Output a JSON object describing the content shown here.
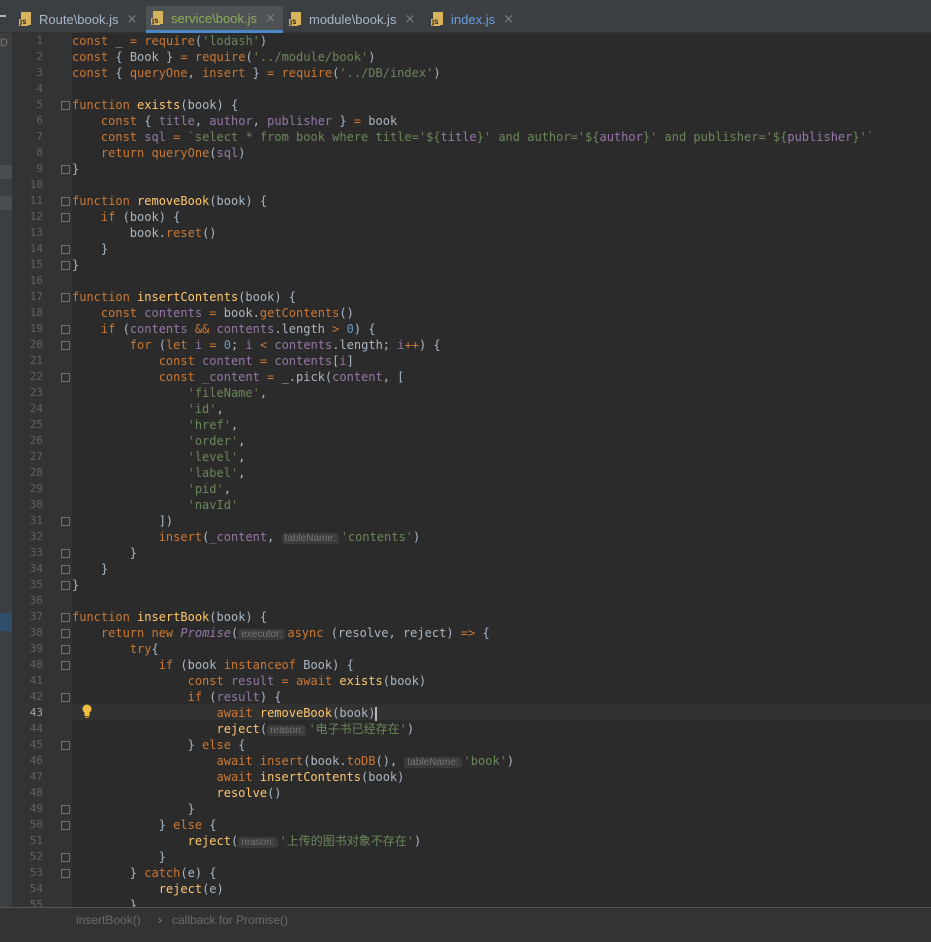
{
  "tabs": [
    {
      "label": "Route\\book.js",
      "color": "#a9b7c6",
      "active": false
    },
    {
      "label": "service\\book.js",
      "color": "#8fac5a",
      "active": true
    },
    {
      "label": "module\\book.js",
      "color": "#a9b7c6",
      "active": false
    },
    {
      "label": "index.js",
      "color": "#6a9ee4",
      "active": false
    }
  ],
  "tab_icon_text": "JS",
  "close_glyph": "×",
  "hints": {
    "tableName": "tableName:",
    "executor": "executor:",
    "reason": "reason:"
  },
  "strings": {
    "book_exists": "'电子书已经存在'",
    "book_missing": "'上传的图书对象不存在'"
  },
  "breadcrumb": {
    "item1": "insertBook()",
    "separator": "›",
    "item2": "callback for Promise()"
  },
  "left_label": "D",
  "line_numbers": [
    1,
    2,
    3,
    4,
    5,
    6,
    7,
    8,
    9,
    10,
    11,
    12,
    13,
    14,
    15,
    16,
    17,
    18,
    19,
    20,
    21,
    22,
    23,
    24,
    25,
    26,
    27,
    28,
    29,
    30,
    31,
    32,
    33,
    34,
    35,
    36,
    37,
    38,
    39,
    40,
    41,
    42,
    43,
    44,
    45,
    46,
    47,
    48,
    49,
    50,
    51,
    52,
    53,
    54,
    55
  ]
}
